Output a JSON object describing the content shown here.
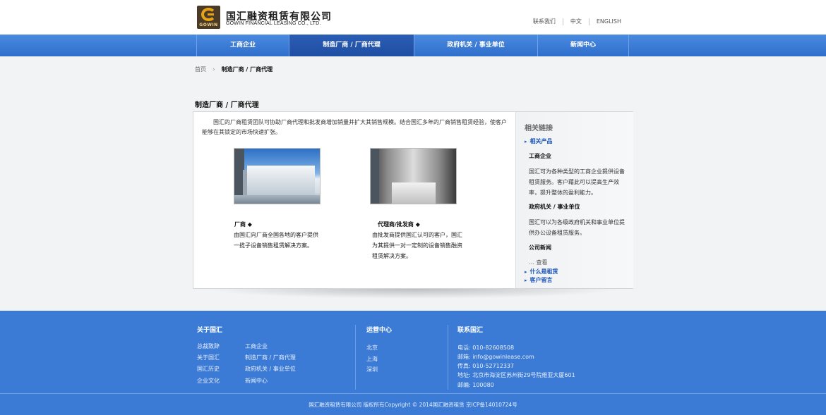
{
  "header": {
    "logo_text": "GOWIN",
    "brand_cn": "国汇融资租赁有限公司",
    "brand_en": "GOWIN FINANCIAL LEASING CO., LTD.",
    "top_links": [
      "联系我们",
      "中文",
      "ENGLISH"
    ]
  },
  "nav": {
    "items": [
      "工商企业",
      "制造厂商 / 厂商代理",
      "政府机关 / 事业单位",
      "新闻中心"
    ],
    "active_index": 1
  },
  "breadcrumb": {
    "home": "首页",
    "current": "制造厂商 / 厂商代理"
  },
  "page_title": "制造厂商 / 厂商代理",
  "intro": "国汇的厂商租赁团队可协助厂商代理和批发商增加销量并扩大其销售规模。结合国汇多年的厂商销售租赁经验，使客户能够在其锁定的市场快速扩张。",
  "products": [
    {
      "title": "厂商 ◆",
      "desc": "由国汇向厂商全国各地的客户提供一揽子设备销售租赁解决方案。"
    },
    {
      "title": "代理商/批发商 ◆",
      "desc": "由批发商提供国汇认可的客户，国汇为其提供一对一定制的设备销售融资租赁解决方案。"
    }
  ],
  "sidebar": {
    "title": "相关链接",
    "related_products": "相关产品",
    "sections": [
      {
        "head": "工商企业",
        "text": "国汇可为各种类型的工商企业提供设备租赁服务。客户藉此可以提高生产效率，提升整体的盈利能力。"
      },
      {
        "head": "政府机关 / 事业单位",
        "text": "国汇可以为各级政府机关和事业单位提供办公设备租赁服务。"
      },
      {
        "head": "公司新闻",
        "text": ""
      }
    ],
    "more": "…  查看",
    "what_is_leasing": "什么是租赁",
    "customer_message": "客户留言"
  },
  "footer": {
    "about": {
      "head": "关于国汇",
      "col1": [
        "总裁致辞",
        "关于国汇",
        "国汇历史",
        "企业文化"
      ],
      "col2": [
        "工商企业",
        "制造厂商 / 厂商代理",
        "政府机关 / 事业单位",
        "新闻中心"
      ]
    },
    "ops": {
      "head": "运营中心",
      "items": [
        "北京",
        "上海",
        "深圳"
      ]
    },
    "contact": {
      "head": "联系国汇",
      "phone": "电话: 010-82608508",
      "email": "邮箱: info@gowinlease.com",
      "fax": "传真: 010-52712337",
      "address": "地址: 北京市海淀区苏州街29号院维亚大厦601",
      "postcode": "邮编: 100080"
    },
    "copyright": "国汇融资租赁有限公司 版权所有Copyright © 2014国汇融资租赁  京ICP备14010724号"
  },
  "colors": {
    "nav_blue": "#3b7bd6",
    "nav_active": "#1f4fa3",
    "link_blue": "#1c55b8",
    "logo_gold": "#e8a317"
  }
}
